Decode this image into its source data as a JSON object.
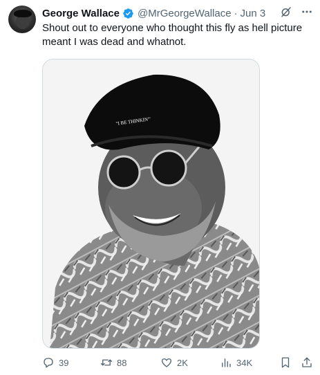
{
  "tweet": {
    "author_name": "George Wallace",
    "handle": "@MrGeorgeWallace",
    "separator": "·",
    "date": "Jun 3",
    "text": "Shout out to everyone who thought this fly as hell picture meant I was dead and whatnot.",
    "hat_text": "\"I BE THINKIN'\""
  },
  "metrics": {
    "replies": "39",
    "reposts": "88",
    "likes": "2K",
    "views": "34K"
  },
  "icons": {
    "verified": "verified-badge-icon",
    "grok": "grok-icon",
    "more": "more-icon",
    "reply": "reply-icon",
    "repost": "repost-icon",
    "like": "heart-icon",
    "views": "views-icon",
    "bookmark": "bookmark-icon",
    "share": "share-icon"
  },
  "colors": {
    "text": "#0f1419",
    "secondary": "#536471",
    "verified": "#1d9bf0",
    "border": "#cfd9de"
  }
}
